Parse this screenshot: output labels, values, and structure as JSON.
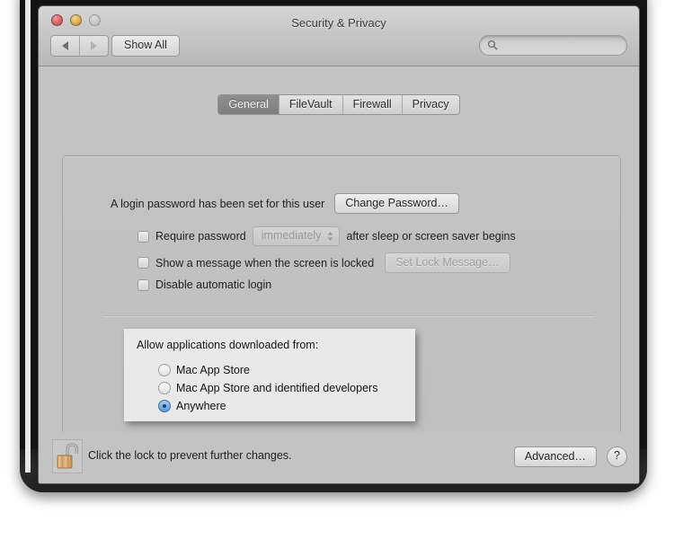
{
  "window": {
    "title": "Security & Privacy",
    "traffic_lights": [
      {
        "name": "close",
        "color": "#d96a6a"
      },
      {
        "name": "minimize",
        "color": "#dfb35a"
      },
      {
        "name": "zoom",
        "color": "#c8c8c8"
      }
    ]
  },
  "toolbar": {
    "back_label": "◀",
    "forward_label": "▶",
    "show_all_label": "Show All",
    "search": {
      "value": "",
      "placeholder": ""
    }
  },
  "tabs": [
    {
      "label": "General",
      "selected": true
    },
    {
      "label": "FileVault",
      "selected": false
    },
    {
      "label": "Firewall",
      "selected": false
    },
    {
      "label": "Privacy",
      "selected": false
    }
  ],
  "general": {
    "password_status": "A login password has been set for this user",
    "change_password_label": "Change Password…",
    "require_password": {
      "checked": false,
      "label_before": "Require password",
      "popup_value": "immediately",
      "label_after": "after sleep or screen saver begins"
    },
    "show_message": {
      "checked": false,
      "label": "Show a message when the screen is locked",
      "button_label": "Set Lock Message…",
      "button_disabled": true
    },
    "disable_auto_login": {
      "checked": false,
      "label": "Disable automatic login"
    },
    "gatekeeper": {
      "heading": "Allow applications downloaded from:",
      "options": [
        {
          "label": "Mac App Store",
          "selected": false
        },
        {
          "label": "Mac App Store and identified developers",
          "selected": false
        },
        {
          "label": "Anywhere",
          "selected": true
        }
      ],
      "selected_color": "#5e9ad6"
    }
  },
  "footer": {
    "lock_icon": "unlocked-padlock-icon",
    "lock_caption": "Click the lock to prevent further changes.",
    "advanced_label": "Advanced…",
    "help_label": "?"
  }
}
